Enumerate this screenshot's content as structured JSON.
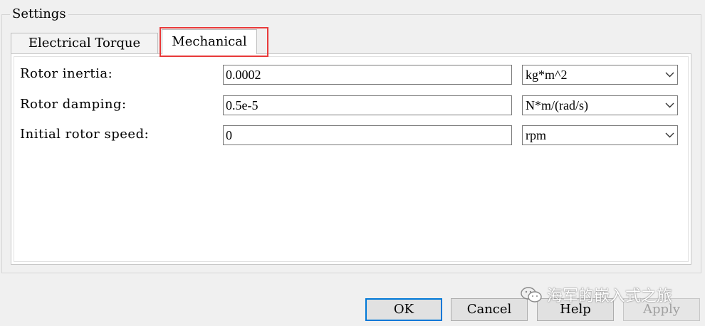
{
  "group": {
    "title": "Settings"
  },
  "tabs": [
    {
      "label": "Electrical Torque",
      "active": false
    },
    {
      "label": "Mechanical",
      "active": true
    }
  ],
  "fields": [
    {
      "label": "Rotor inertia:",
      "value": "0.0002",
      "unit": "kg*m^2"
    },
    {
      "label": "Rotor damping:",
      "value": "0.5e-5",
      "unit": "N*m/(rad/s)"
    },
    {
      "label": "Initial rotor speed:",
      "value": "0",
      "unit": "rpm"
    }
  ],
  "buttons": {
    "ok": "OK",
    "cancel": "Cancel",
    "help": "Help",
    "apply": "Apply"
  },
  "watermark": {
    "text": "海军的嵌入式之旅",
    "icon": "wechat-icon"
  },
  "colors": {
    "highlight": "#e83a3a",
    "default_button_border": "#0078d7",
    "disabled_text": "#a0a0a0"
  }
}
